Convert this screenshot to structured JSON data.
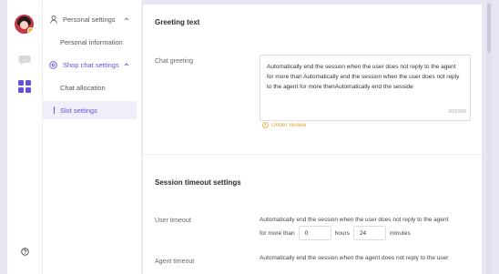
{
  "sidebar": {
    "groups": [
      {
        "label": "Personal settings",
        "icon": "user-icon"
      },
      {
        "label": "Shop chat settings",
        "icon": "shop-settings-icon"
      }
    ],
    "items": [
      {
        "label": "Personal information"
      },
      {
        "label": "Chat allocation"
      },
      {
        "label": "Slot settings"
      }
    ]
  },
  "main": {
    "greeting": {
      "section_title": "Greeting text",
      "label": "Chat greeting",
      "value": "Automatically end the session when the user does not reply to the agent for more than Automatically end the session when the user does not reply to the agent for more thenAutomatically end the sesside",
      "counter": "200/200",
      "status": "Under review"
    },
    "timeout": {
      "section_title": "Session timeout settings",
      "user_label": "User timeout",
      "user_desc": "Automatically end the session when the user does not reply to the agent",
      "for_more_than": "for more than",
      "hours_value": "0",
      "hours_label": "hours",
      "minutes_value": "24",
      "minutes_label": "minutes",
      "agent_label": "Agent timeout",
      "agent_desc": "Automatically end the session when the agent does not reply to the user"
    }
  },
  "colors": {
    "accent": "#6a4fd8",
    "warning": "#e3a42b",
    "background": "#e7e6f3"
  }
}
